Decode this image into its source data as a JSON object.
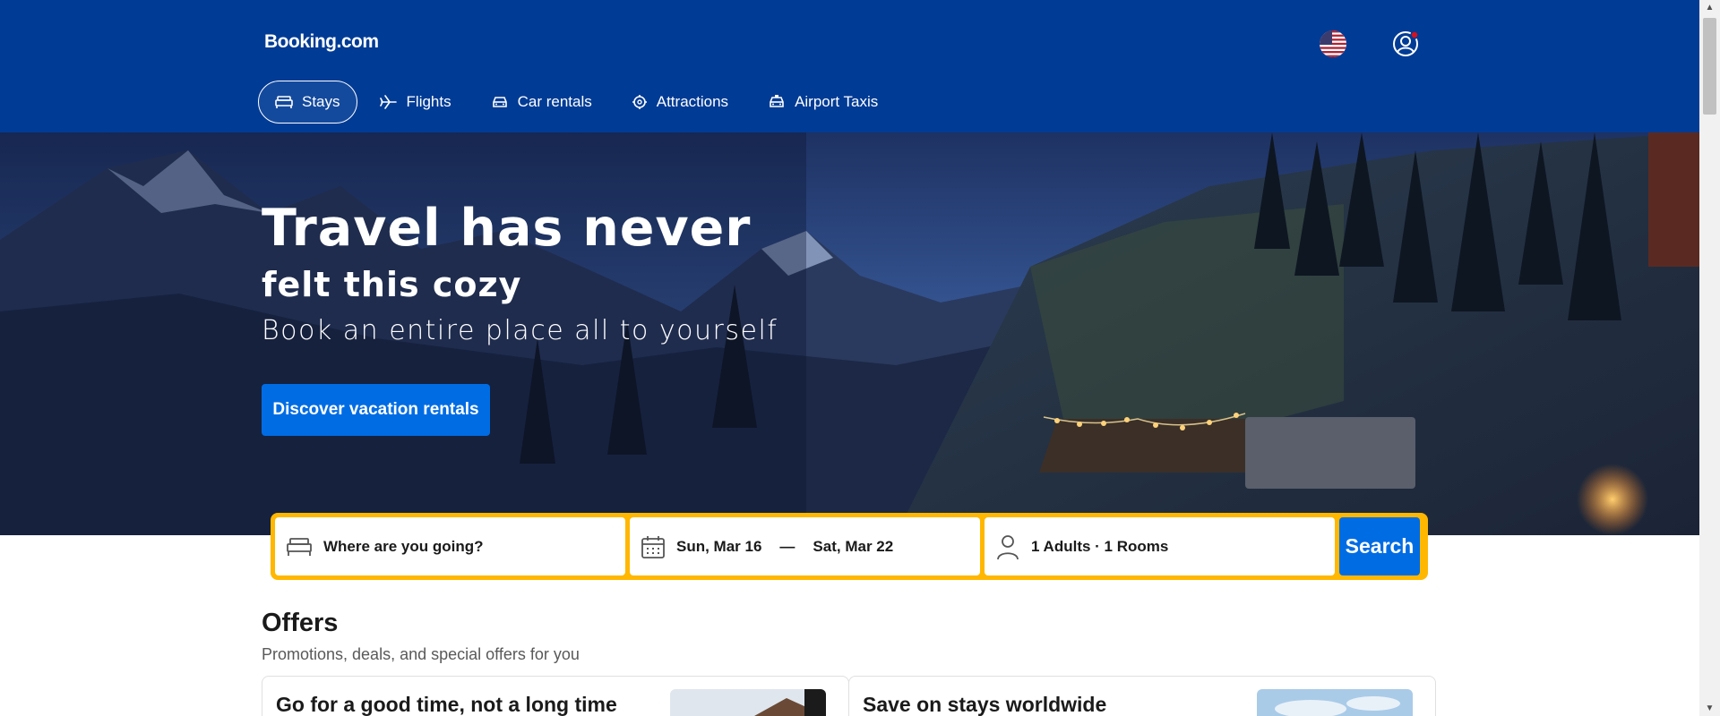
{
  "header": {
    "logo": "Booking.com",
    "nav": [
      {
        "label": "Stays",
        "icon": "bed-icon",
        "active": true
      },
      {
        "label": "Flights",
        "icon": "plane-icon",
        "active": false
      },
      {
        "label": "Car rentals",
        "icon": "car-icon",
        "active": false
      },
      {
        "label": "Attractions",
        "icon": "attractions-icon",
        "active": false
      },
      {
        "label": "Airport Taxis",
        "icon": "taxi-icon",
        "active": false
      }
    ]
  },
  "hero": {
    "title_line1": "Travel has never",
    "title_line2": "felt this cozy",
    "subtitle": "Book an entire place all to yourself",
    "cta": "Discover vacation rentals"
  },
  "search": {
    "destination_placeholder": "Where are you going?",
    "check_in": "Sun, Mar 16",
    "separator": "—",
    "check_out": "Sat, Mar 22",
    "guests": "1 Adults · 1 Rooms",
    "button": "Search"
  },
  "offers": {
    "title": "Offers",
    "subtitle": "Promotions, deals, and special offers for you",
    "cards": [
      {
        "title": "Go for a good time, not a long time"
      },
      {
        "title": "Save on stays worldwide"
      }
    ]
  },
  "colors": {
    "brand_blue": "#003b95",
    "action_blue": "#006ce4",
    "search_border": "#ffb700"
  }
}
